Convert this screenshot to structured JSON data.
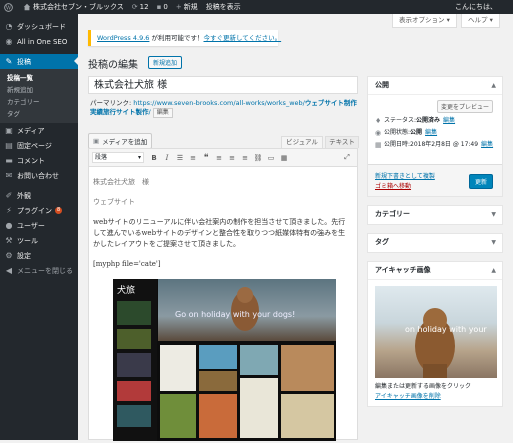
{
  "adminbar": {
    "site_name": "株式会社セブン・ブルックス",
    "updates": "12",
    "comments": "0",
    "new_label": "新規",
    "view_post": "投稿を表示",
    "greeting": "こんにちは、"
  },
  "menu": {
    "dashboard": "ダッシュボード",
    "aioseo": "All in One SEO",
    "posts": "投稿",
    "posts_sub": [
      "投稿一覧",
      "新規追加",
      "カテゴリー",
      "タグ"
    ],
    "media": "メディア",
    "pages": "固定ページ",
    "comments": "コメント",
    "contact": "お問い合わせ",
    "appearance": "外観",
    "plugins": "プラグイン",
    "plugins_badge": "8",
    "users": "ユーザー",
    "tools": "ツール",
    "settings": "設定",
    "collapse": "メニューを閉じる"
  },
  "screen_options": "表示オプション ▾",
  "help": "ヘルプ ▾",
  "notice": {
    "text_link": "WordPress 4.9.6",
    "text_mid": " が利用可能です！",
    "update_link": "今すぐ更新してください。"
  },
  "page_title": "投稿の編集",
  "add_new": "新規追加",
  "post_title": "株式会社犬旅 様",
  "permalink": {
    "label": "パーマリンク: ",
    "url": "https://www.seven-brooks.com/all-works/works_web/",
    "slug": "ウェブサイト制作実績旅行サイト製作",
    "slug2": "/",
    "edit": "編集"
  },
  "add_media": "メディアを追加",
  "tabs": {
    "visual": "ビジュアル",
    "text": "テキスト"
  },
  "format_select": "段落",
  "content": {
    "line1": "株式会社犬旅　様",
    "line2": "ウェブサイト",
    "para": "webサイトのリニューアルに伴い会社案内の制作を担当させて頂きました。先行して進んでいるwebサイトのデザインと整合性を取りつつ紙媒体特有の強みを生かしたレイアウトをご提案させて頂きました。",
    "shortcode": "[myphp file='cate']",
    "hero_text": "Go on holiday with your dogs!"
  },
  "publish": {
    "title": "公開",
    "preview": "変更をプレビュー",
    "status_label": "ステータス: ",
    "status_value": "公開済み",
    "visibility_label": "公開状態: ",
    "visibility_value": "公開",
    "date_label": "公開日時: ",
    "date_value": "2018年2月8日 @ 17:49",
    "edit": "編集",
    "copy_draft": "新規下書きとして複製",
    "trash": "ゴミ箱へ移動",
    "update": "更新"
  },
  "category_box": "カテゴリー",
  "tag_box": "タグ",
  "featured": {
    "title": "アイキャッチ画像",
    "img_text": "on holiday with your",
    "hint": "編集または更新する画像をクリック",
    "remove": "アイキャッチ画像を削除"
  },
  "colors": {
    "accent": "#0073aa",
    "menu_bg": "#23282d",
    "notice": "#ffb900",
    "update_btn": "#0085ba"
  }
}
